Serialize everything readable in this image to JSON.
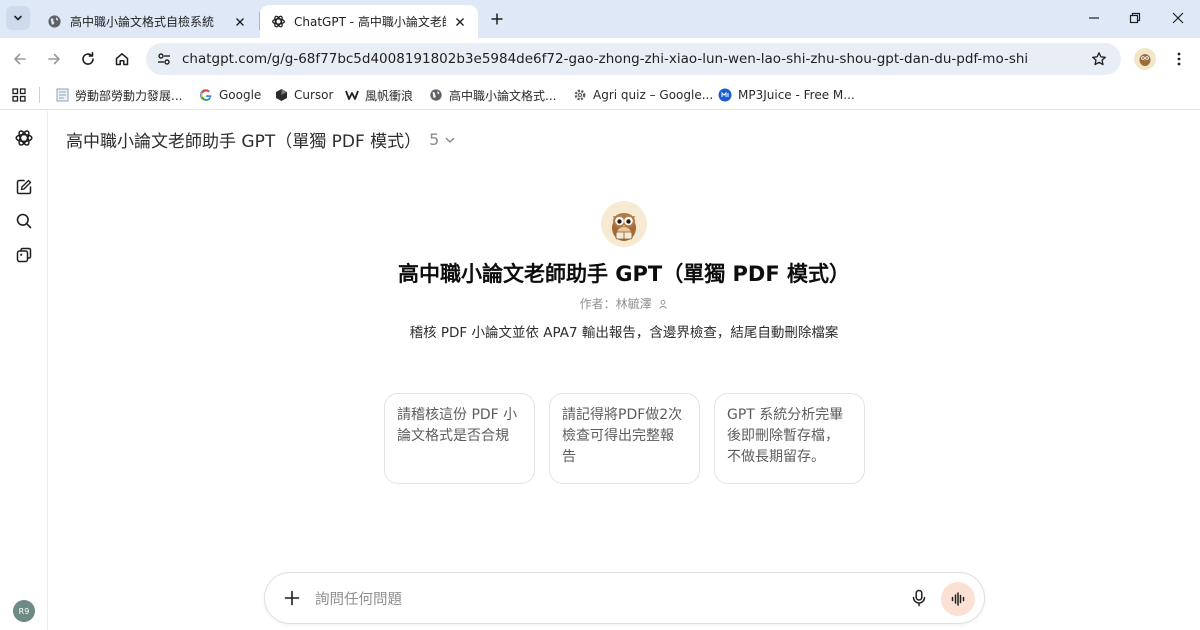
{
  "browser": {
    "tabs": [
      {
        "title": "高中職小論文格式自檢系統",
        "icon": "globe-icon",
        "active": false
      },
      {
        "title": "ChatGPT - 高中職小論文老師助手",
        "icon": "openai-icon",
        "active": true
      }
    ],
    "url": "chatgpt.com/g/g-68f77bc5d4008191802b3e5984de6f72-gao-zhong-zhi-xiao-lun-wen-lao-shi-zhu-shou-gpt-dan-du-pdf-mo-shi",
    "bookmarks": [
      {
        "label": "勞動部勞動力發展...",
        "icon": "doc-icon"
      },
      {
        "label": "Google",
        "icon": "google-icon"
      },
      {
        "label": "Cursor",
        "icon": "cursor-icon"
      },
      {
        "label": "風帆衝浪",
        "icon": "w-icon"
      },
      {
        "label": "高中職小論文格式...",
        "icon": "globe-icon"
      },
      {
        "label": "Agri quiz – Google...",
        "icon": "gear-icon"
      },
      {
        "label": "MP3Juice - Free M...",
        "icon": "music-icon"
      }
    ]
  },
  "app": {
    "gpt_name": "高中職小論文老師助手 GPT（單獨 PDF 模式）",
    "version": "5",
    "author": "作者：林毓澤",
    "description": "稽核 PDF 小論文並依 APA7 輸出報告，含邊界檢查，結尾自動刪除檔案",
    "starters": [
      "請稽核這份 PDF 小論文格式是否合規",
      "請記得將PDF做2次檢查可得出完整報告",
      "GPT 系統分析完畢後即刪除暫存檔，不做長期留存。"
    ],
    "composer_placeholder": "詢問任何問題",
    "user_initials": "R9"
  },
  "colors": {
    "tabstrip": "#dfe8f7",
    "omnibox": "#e9eef6",
    "voice_button": "#fbe1d3",
    "avatar": "#6d8b84"
  }
}
